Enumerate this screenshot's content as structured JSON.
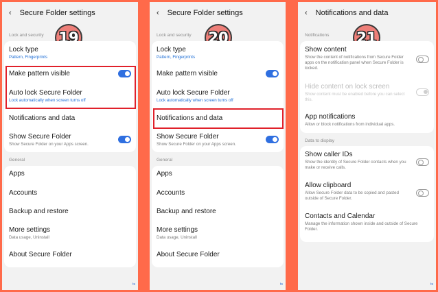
{
  "panels": [
    {
      "header": {
        "back_icon": "‹",
        "title": "Secure Folder settings"
      },
      "badge": "19",
      "sections": {
        "lock": "Lock and security",
        "general": "General"
      },
      "items": {
        "lock_type": {
          "title": "Lock type",
          "sub": "Pattern, Fingerprints"
        },
        "pattern_visible": {
          "title": "Make pattern visible"
        },
        "auto_lock": {
          "title": "Auto lock Secure Folder",
          "sub": "Lock automatically when screen turns off"
        },
        "notifications": {
          "title": "Notifications and data"
        },
        "show_folder": {
          "title": "Show Secure Folder",
          "sub": "Show Secure Folder on your Apps screen."
        },
        "apps": {
          "title": "Apps"
        },
        "accounts": {
          "title": "Accounts"
        },
        "backup": {
          "title": "Backup and restore"
        },
        "more": {
          "title": "More settings",
          "sub": "Data usage, Uninstall"
        },
        "about": {
          "title": "About Secure Folder"
        }
      },
      "corner": "ts"
    },
    {
      "header": {
        "back_icon": "‹",
        "title": "Secure Folder settings"
      },
      "badge": "20",
      "sections": {
        "lock": "Lock and security",
        "general": "General"
      },
      "items": {
        "lock_type": {
          "title": "Lock type",
          "sub": "Pattern, Fingerprints"
        },
        "pattern_visible": {
          "title": "Make pattern visible"
        },
        "auto_lock": {
          "title": "Auto lock Secure Folder",
          "sub": "Lock automatically when screen turns off"
        },
        "notifications": {
          "title": "Notifications and data"
        },
        "show_folder": {
          "title": "Show Secure Folder",
          "sub": "Show Secure Folder on your Apps screen."
        },
        "apps": {
          "title": "Apps"
        },
        "accounts": {
          "title": "Accounts"
        },
        "backup": {
          "title": "Backup and restore"
        },
        "more": {
          "title": "More settings",
          "sub": "Data usage, Uninstall"
        },
        "about": {
          "title": "About Secure Folder"
        }
      },
      "corner": "ts"
    },
    {
      "header": {
        "back_icon": "‹",
        "title": "Notifications and data"
      },
      "badge": "21",
      "sections": {
        "notifications": "Notifications",
        "display": "Data to display"
      },
      "items": {
        "show_content": {
          "title": "Show content",
          "sub": "Show the content of notifications from Secure Folder apps on the notification panel when Secure Folder is locked."
        },
        "hide_content": {
          "title": "Hide content on lock screen",
          "sub": "Show content must be enabled before you can select this."
        },
        "app_notifications": {
          "title": "App notifications",
          "sub": "Allow or block notifications from individual apps."
        },
        "caller_ids": {
          "title": "Show caller IDs",
          "sub": "Show the identity of Secure Folder contacts when you make or receive calls."
        },
        "clipboard": {
          "title": "Allow clipboard",
          "sub": "Allow Secure Folder data to be copied and pasted outside of Secure Folder."
        },
        "contacts_calendar": {
          "title": "Contacts and Calendar",
          "sub": "Manage the information shown inside and outside of Secure Folder."
        }
      },
      "corner": "ts"
    }
  ],
  "colors": {
    "accent": "#2f6fe0",
    "highlight": "#e0202a",
    "background": "#ff6a4a",
    "badge": "#ee7f79"
  }
}
